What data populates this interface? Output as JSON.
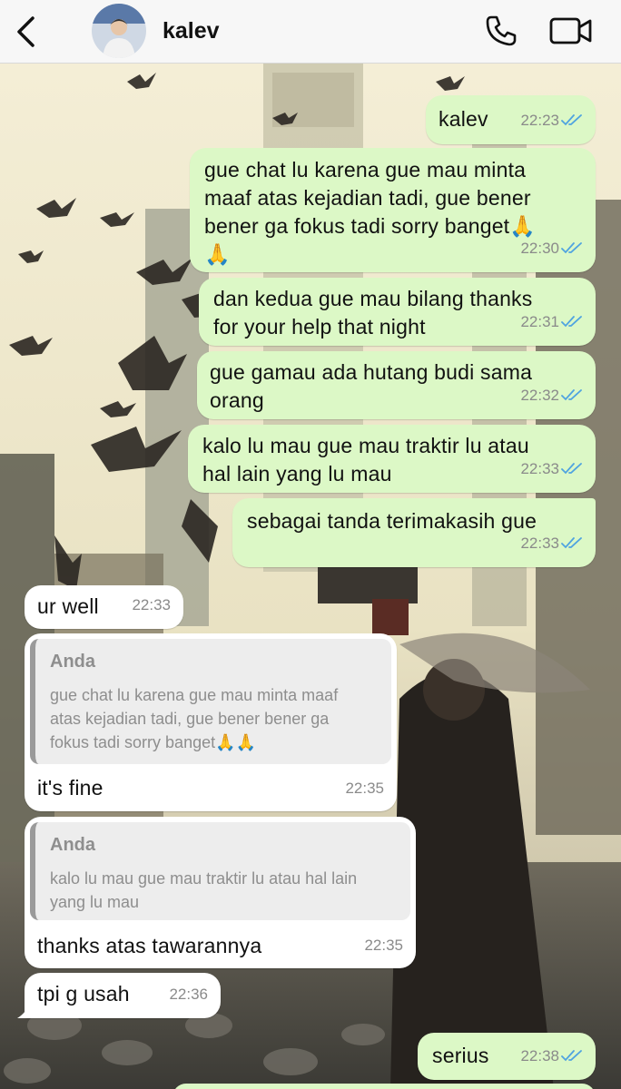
{
  "header": {
    "contact_name": "kalev",
    "icons": [
      "back-chevron-icon",
      "avatar",
      "phone-icon",
      "video-camera-icon"
    ]
  },
  "messages": [
    {
      "direction": "out",
      "text": "kalev",
      "time": "22:23",
      "read": true
    },
    {
      "direction": "out",
      "text": "gue chat lu karena gue mau minta\nmaaf atas kejadian tadi, gue bener\nbener ga fokus tadi sorry banget🙏\n🙏",
      "time": "22:30",
      "read": true
    },
    {
      "direction": "out",
      "text": "dan kedua gue mau bilang thanks\nfor your help that night",
      "time": "22:31",
      "read": true
    },
    {
      "direction": "out",
      "text": "gue gamau ada hutang budi sama\norang",
      "time": "22:32",
      "read": true
    },
    {
      "direction": "out",
      "text": "kalo lu mau gue mau traktir lu atau\nhal lain yang lu mau",
      "time": "22:33",
      "read": true
    },
    {
      "direction": "out",
      "text": "sebagai tanda terimakasih gue",
      "time": "22:33",
      "read": true
    },
    {
      "direction": "in",
      "text": "ur well",
      "time": "22:33"
    },
    {
      "direction": "in",
      "text": "it's fine",
      "time": "22:35",
      "reply_to": {
        "name": "Anda",
        "text": "gue chat lu karena gue mau minta maaf\natas kejadian tadi, gue bener bener ga\nfokus tadi sorry banget🙏🙏"
      }
    },
    {
      "direction": "in",
      "text": "thanks atas tawarannya",
      "time": "22:35",
      "reply_to": {
        "name": "Anda",
        "text": "kalo lu mau gue mau traktir lu atau hal lain\nyang lu mau"
      }
    },
    {
      "direction": "in",
      "text": "tpi g usah",
      "time": "22:36"
    },
    {
      "direction": "out",
      "text": "serius",
      "time": "22:38",
      "read": true
    }
  ],
  "colors": {
    "outgoing_bubble": "#dcf8c6",
    "incoming_bubble": "#ffffff",
    "read_ticks": "#4fa3e0",
    "header_bg": "#f7f7f7"
  }
}
